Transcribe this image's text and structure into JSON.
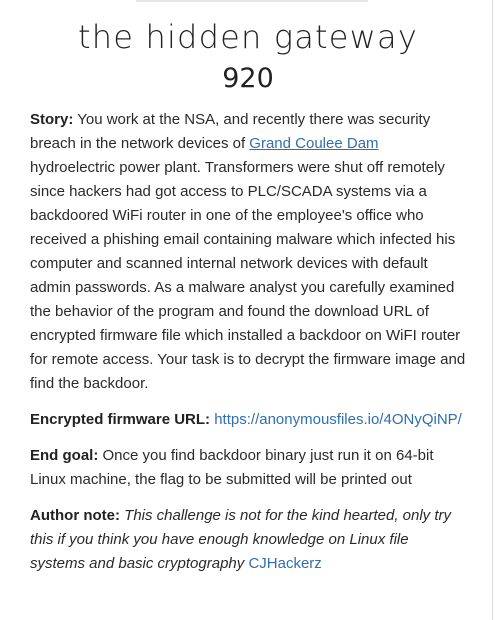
{
  "challenge": {
    "title": "the hidden gateway",
    "points": "920"
  },
  "story": {
    "label": "Story:",
    "text_before_link": " You work at the NSA, and recently there was security breach in the network devices of ",
    "link_text": "Grand Coulee Dam",
    "text_after_link": " hydroelectric power plant. Transformers were shut off remotely since hackers had got access to PLC/SCADA systems via a backdoored WiFi router in one of the employee's office who received a phishing email containing malware which infected his computer and scanned internal network devices with default admin passwords. As a malware analyst you carefully examined the behavior of the program and found the download URL of encrypted firmware file which installed a backdoor on WiFI router for remote access. Your task is to decrypt the firmware image and find the backdoor."
  },
  "firmware": {
    "label": "Encrypted firmware URL:",
    "url_text": "https://anonymousfiles.io/4ONyQiNP/"
  },
  "goal": {
    "label": "End goal:",
    "text": " Once you find backdoor binary just run it on 64-bit Linux machine, the flag to be submitted will be printed out"
  },
  "author_note": {
    "label": "Author note:",
    "text": "This challenge is not for the kind hearted, only try this if you think you have enough knowledge on Linux file systems and basic cryptography",
    "author_link": "CJHackerz"
  }
}
